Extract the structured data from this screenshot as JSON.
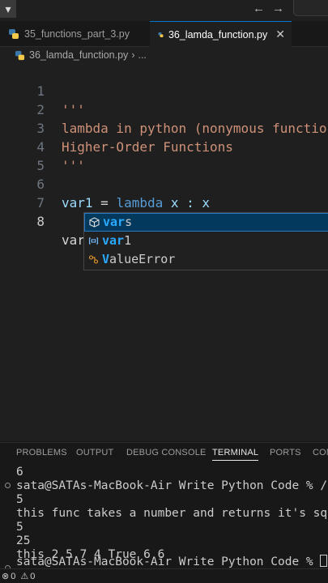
{
  "titlebar": {
    "back_icon": "arrow-left-icon",
    "forward_icon": "arrow-right-icon",
    "menu_glyph": "▾"
  },
  "tabs": [
    {
      "label": "35_functions_part_3.py",
      "icon": "python-icon",
      "active": false
    },
    {
      "label": "36_lamda_function.py",
      "icon": "python-icon",
      "active": true,
      "close": "✕"
    }
  ],
  "breadcrumb": {
    "file": "36_lamda_function.py",
    "sep": "›",
    "more": "..."
  },
  "editor": {
    "lines": [
      {
        "n": "1",
        "text": "'''"
      },
      {
        "n": "2",
        "text": "lambda in python (nonymous function)"
      },
      {
        "n": "3",
        "text": "Higher-Order Functions"
      },
      {
        "n": "4",
        "text": "'''"
      },
      {
        "n": "5",
        "text": ""
      },
      {
        "n": "6",
        "parts": [
          "var1",
          " = ",
          "lambda",
          " x : x"
        ]
      },
      {
        "n": "7",
        "text": ""
      },
      {
        "n": "8",
        "text": "var"
      }
    ]
  },
  "suggest": [
    {
      "match": "var",
      "rest": "s",
      "icon": "cube-icon",
      "selected": true
    },
    {
      "match": "var",
      "rest": "1",
      "icon": "variable-icon",
      "selected": false
    },
    {
      "match": "V",
      "rest": "alueError",
      "icon": "class-icon",
      "selected": false
    }
  ],
  "panel": {
    "tabs": [
      "PROBLEMS",
      "OUTPUT",
      "DEBUG CONSOLE",
      "TERMINAL",
      "PORTS",
      "COM"
    ],
    "active": "TERMINAL"
  },
  "terminal": {
    "lines": [
      "6",
      "sata@SATAs-MacBook-Air Write Python Code % /usr/",
      "5",
      "this func takes a number and returns it's square",
      "5",
      "25",
      "this 2 5.7 4 True 6 6",
      "sata@SATAs-MacBook-Air Write Python Code % "
    ]
  },
  "status": {
    "errors": "0",
    "warnings": "0"
  }
}
